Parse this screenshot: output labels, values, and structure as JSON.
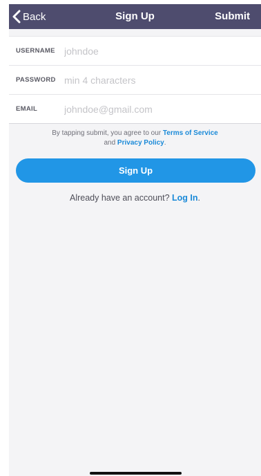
{
  "nav": {
    "back_label": "Back",
    "title": "Sign Up",
    "submit_label": "Submit"
  },
  "form": {
    "username": {
      "label": "USERNAME",
      "placeholder": "johndoe",
      "value": ""
    },
    "password": {
      "label": "PASSWORD",
      "placeholder": "min 4 characters",
      "value": ""
    },
    "email": {
      "label": "EMAIL",
      "placeholder": "johndoe@gmail.com",
      "value": ""
    }
  },
  "terms": {
    "prefix": "By tapping submit, you agree to our ",
    "tos_link": "Terms of Service",
    "middle": "and ",
    "privacy_link": "Privacy Policy",
    "suffix": "."
  },
  "signup_button": {
    "label": "Sign Up"
  },
  "login": {
    "prompt": "Already have an account? ",
    "link": "Log In",
    "suffix": "."
  },
  "colors": {
    "nav_background": "#4e4c6e",
    "accent": "#2196e6",
    "link": "#1b8ad8",
    "page_background": "#f4f4f6"
  },
  "icons": {
    "back": "chevron-left-icon"
  }
}
